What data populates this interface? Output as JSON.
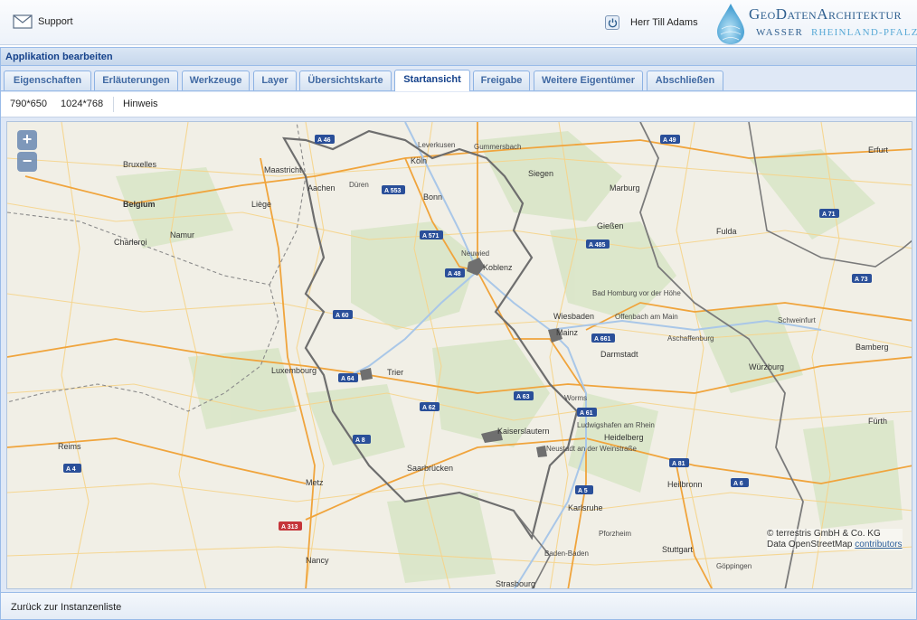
{
  "header": {
    "support_label": "Support",
    "user_name": "Herr Till Adams",
    "logo": {
      "title": "GeoDatenArchitektur",
      "subtitle_left": "WASSER",
      "subtitle_right": "RHEINLAND-PFALZ"
    }
  },
  "panel": {
    "title": "Applikation bearbeiten",
    "tabs": [
      {
        "label": "Eigenschaften"
      },
      {
        "label": "Erläuterungen"
      },
      {
        "label": "Werkzeuge"
      },
      {
        "label": "Layer"
      },
      {
        "label": "Übersichtskarte"
      },
      {
        "label": "Startansicht",
        "active": true
      },
      {
        "label": "Freigabe"
      },
      {
        "label": "Weitere Eigentümer"
      },
      {
        "label": "Abschließen"
      }
    ],
    "toolbar": {
      "size_small": "790*650",
      "size_large": "1024*768",
      "hint": "Hinweis"
    }
  },
  "map": {
    "zoom_in": "+",
    "zoom_out": "−",
    "attribution_line1": "© terrestris GmbH & Co. KG",
    "attribution_line2_prefix": "Data OpenStreetMap",
    "attribution_link": "contributors",
    "cities": [
      {
        "name": "Köln"
      },
      {
        "name": "Aachen"
      },
      {
        "name": "Bonn"
      },
      {
        "name": "Siegen"
      },
      {
        "name": "Koblenz"
      },
      {
        "name": "Wiesbaden"
      },
      {
        "name": "Mainz"
      },
      {
        "name": "Darmstadt"
      },
      {
        "name": "Trier"
      },
      {
        "name": "Luxembourg"
      },
      {
        "name": "Saarbrücken"
      },
      {
        "name": "Kaiserslautern"
      },
      {
        "name": "Ludwigshafen am Rhein"
      },
      {
        "name": "Heidelberg"
      },
      {
        "name": "Karlsruhe"
      },
      {
        "name": "Metz"
      },
      {
        "name": "Nancy"
      },
      {
        "name": "Strasbourg"
      },
      {
        "name": "Würzburg"
      },
      {
        "name": "Heilbronn"
      },
      {
        "name": "Stuttgart"
      },
      {
        "name": "Fulda"
      },
      {
        "name": "Marburg"
      },
      {
        "name": "Gießen"
      },
      {
        "name": "Liège"
      },
      {
        "name": "Namur"
      },
      {
        "name": "Maastricht"
      },
      {
        "name": "Bruxelles"
      },
      {
        "name": "Belgium"
      },
      {
        "name": "Charleroi"
      },
      {
        "name": "Reims"
      },
      {
        "name": "Erfurt"
      },
      {
        "name": "Bamberg"
      },
      {
        "name": "Fürth"
      },
      {
        "name": "Aschaffenburg"
      },
      {
        "name": "Worms"
      },
      {
        "name": "Neuwied"
      },
      {
        "name": "Offenbach am Main"
      },
      {
        "name": "Bad Homburg vor der Höhe"
      },
      {
        "name": "Schweinfurt"
      },
      {
        "name": "Gummersbach"
      },
      {
        "name": "Leverkusen"
      },
      {
        "name": "Düren"
      },
      {
        "name": "Baden-Baden"
      },
      {
        "name": "Pforzheim"
      },
      {
        "name": "Göppingen"
      },
      {
        "name": "Neustadt an der Weinstraße"
      }
    ],
    "highways": [
      {
        "name": "A 46"
      },
      {
        "name": "A 49"
      },
      {
        "name": "A 553"
      },
      {
        "name": "A 571"
      },
      {
        "name": "A 48"
      },
      {
        "name": "A 485"
      },
      {
        "name": "A 71"
      },
      {
        "name": "A 73"
      },
      {
        "name": "A 60"
      },
      {
        "name": "A 64"
      },
      {
        "name": "A 661"
      },
      {
        "name": "A 63"
      },
      {
        "name": "A 62"
      },
      {
        "name": "A 61"
      },
      {
        "name": "A 8"
      },
      {
        "name": "A 81"
      },
      {
        "name": "A 6"
      },
      {
        "name": "A 5"
      },
      {
        "name": "A 4"
      },
      {
        "name": "A 313"
      }
    ]
  },
  "footer": {
    "back_label": "Zurück zur Instanzenliste"
  }
}
